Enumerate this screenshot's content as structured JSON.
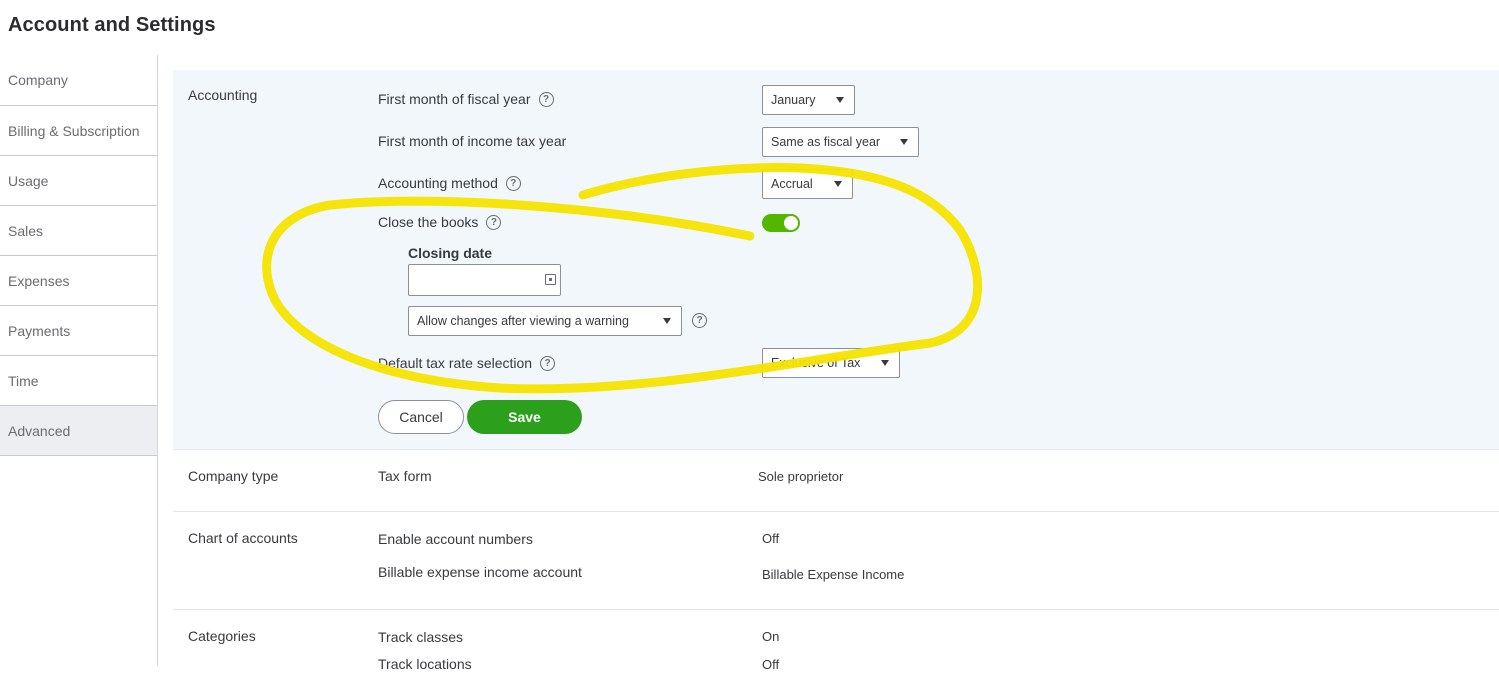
{
  "page": {
    "title": "Account and Settings"
  },
  "sidebar": {
    "items": [
      {
        "label": "Company"
      },
      {
        "label": "Billing & Subscription"
      },
      {
        "label": "Usage"
      },
      {
        "label": "Sales"
      },
      {
        "label": "Expenses"
      },
      {
        "label": "Payments"
      },
      {
        "label": "Time"
      },
      {
        "label": "Advanced",
        "active": true
      }
    ]
  },
  "accounting": {
    "title": "Accounting",
    "fiscal_year": {
      "label": "First month of fiscal year",
      "value": "January"
    },
    "income_tax_year": {
      "label": "First month of income tax year",
      "value": "Same as fiscal year"
    },
    "accounting_method": {
      "label": "Accounting method",
      "value": "Accrual"
    },
    "close_books": {
      "label": "Close the books",
      "enabled": true
    },
    "closing_date": {
      "label": "Closing date",
      "value": ""
    },
    "closing_option": {
      "value": "Allow changes after viewing a warning"
    },
    "default_tax_rate": {
      "label": "Default tax rate selection",
      "value": "Exclusive of Tax"
    },
    "cancel_label": "Cancel",
    "save_label": "Save"
  },
  "company_type": {
    "title": "Company type",
    "tax_form": {
      "label": "Tax form",
      "value": "Sole proprietor"
    }
  },
  "chart_of_accounts": {
    "title": "Chart of accounts",
    "account_numbers": {
      "label": "Enable account numbers",
      "value": "Off"
    },
    "billable_expense": {
      "label": "Billable expense income account",
      "value": "Billable Expense Income"
    }
  },
  "categories": {
    "title": "Categories",
    "track_classes": {
      "label": "Track classes",
      "value": "On"
    },
    "track_locations": {
      "label": "Track locations",
      "value": "Off"
    }
  },
  "icons": {
    "help": "help-circle-icon",
    "dropdown": "caret-down-icon",
    "calendar": "calendar-icon"
  },
  "colors": {
    "accent": "#2ca01c",
    "toggle_on": "#53b700",
    "highlight": "#f5e400"
  }
}
